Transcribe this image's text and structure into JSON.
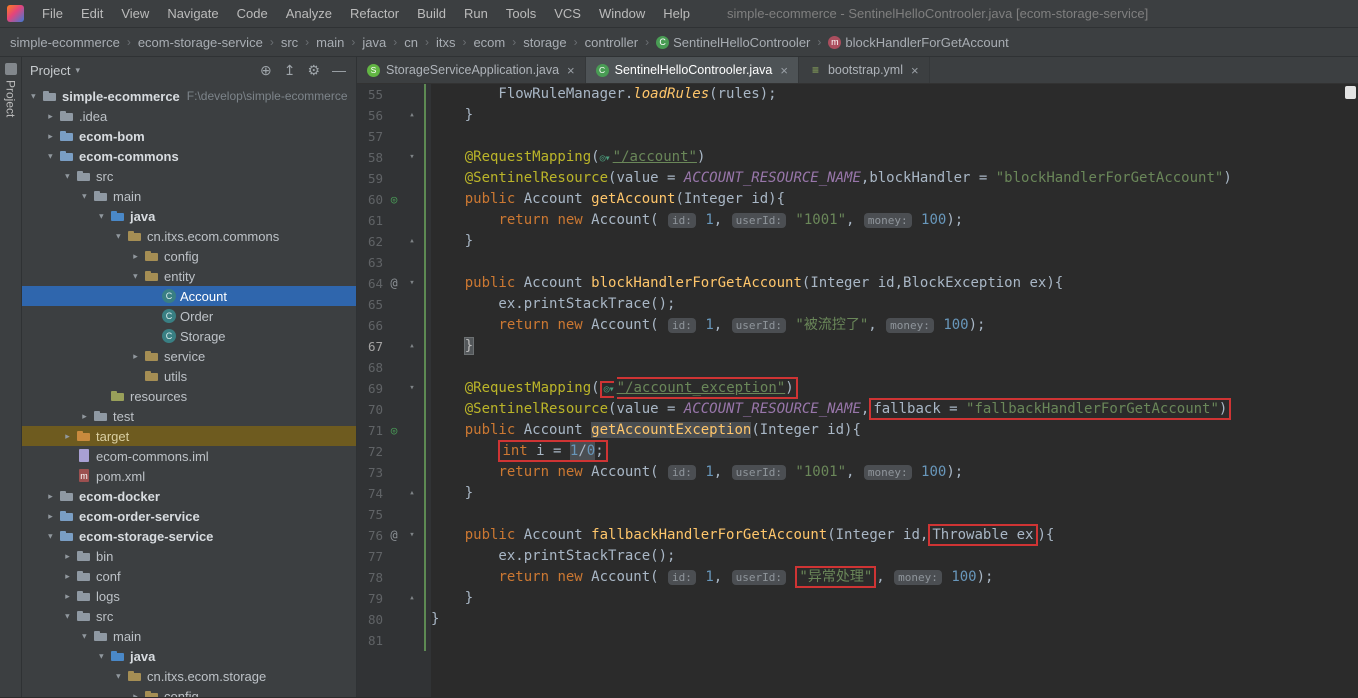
{
  "colors": {
    "selection_blue": "#2f66ad",
    "excluded_row": "#6e5b1f",
    "annotation_box_red": "#cf3434",
    "vcs_change_green": "#5d8a53"
  },
  "titlebar": {
    "title": "simple-ecommerce - SentinelHelloControoler.java [ecom-storage-service]",
    "menu": [
      "File",
      "Edit",
      "View",
      "Navigate",
      "Code",
      "Analyze",
      "Refactor",
      "Build",
      "Run",
      "Tools",
      "VCS",
      "Window",
      "Help"
    ]
  },
  "breadcrumbs": [
    {
      "label": "simple-ecommerce"
    },
    {
      "label": "ecom-storage-service"
    },
    {
      "label": "src"
    },
    {
      "label": "main"
    },
    {
      "label": "java"
    },
    {
      "label": "cn"
    },
    {
      "label": "itxs"
    },
    {
      "label": "ecom"
    },
    {
      "label": "storage"
    },
    {
      "label": "controller"
    },
    {
      "label": "SentinelHelloControoler",
      "icon": "class"
    },
    {
      "label": "blockHandlerForGetAccount",
      "icon": "method"
    }
  ],
  "activity_bar": {
    "project_label": "Project"
  },
  "project_panel": {
    "header": {
      "title": "Project",
      "caret": "▾",
      "actions": [
        {
          "name": "locate-file-icon",
          "glyph": "⊕"
        },
        {
          "name": "collapse-all-icon",
          "glyph": "↥"
        },
        {
          "name": "settings-gear-icon",
          "glyph": "⚙"
        },
        {
          "name": "hide-panel-icon",
          "glyph": "—"
        }
      ]
    },
    "tree": [
      {
        "label": "simple-ecommerce",
        "extra": "F:\\develop\\simple-ecommerce",
        "depth": 0,
        "arrow": "v",
        "icon": "project",
        "bold": true
      },
      {
        "label": ".idea",
        "depth": 1,
        "arrow": ">",
        "icon": "folder"
      },
      {
        "label": "ecom-bom",
        "depth": 1,
        "arrow": ">",
        "icon": "module",
        "bold": true
      },
      {
        "label": "ecom-commons",
        "depth": 1,
        "arrow": "v",
        "icon": "module",
        "bold": true
      },
      {
        "label": "src",
        "depth": 2,
        "arrow": "v",
        "icon": "folder"
      },
      {
        "label": "main",
        "depth": 3,
        "arrow": "v",
        "icon": "folder"
      },
      {
        "label": "java",
        "depth": 4,
        "arrow": "v",
        "icon": "src",
        "bold": true
      },
      {
        "label": "cn.itxs.ecom.commons",
        "depth": 5,
        "arrow": "v",
        "icon": "pkg"
      },
      {
        "label": "config",
        "depth": 6,
        "arrow": ">",
        "icon": "pkg"
      },
      {
        "label": "entity",
        "depth": 6,
        "arrow": "v",
        "icon": "pkg"
      },
      {
        "label": "Account",
        "depth": 7,
        "arrow": "",
        "icon": "class",
        "selected": true
      },
      {
        "label": "Order",
        "depth": 7,
        "arrow": "",
        "icon": "class"
      },
      {
        "label": "Storage",
        "depth": 7,
        "arrow": "",
        "icon": "class"
      },
      {
        "label": "service",
        "depth": 6,
        "arrow": ">",
        "icon": "pkg"
      },
      {
        "label": "utils",
        "depth": 6,
        "arrow": "",
        "icon": "pkg"
      },
      {
        "label": "resources",
        "depth": 4,
        "arrow": "",
        "icon": "res"
      },
      {
        "label": "test",
        "depth": 3,
        "arrow": ">",
        "icon": "folder"
      },
      {
        "label": "target",
        "depth": 2,
        "arrow": ">",
        "icon": "folder-excl",
        "excluded": true
      },
      {
        "label": "ecom-commons.iml",
        "depth": 2,
        "arrow": "",
        "icon": "iml"
      },
      {
        "label": "pom.xml",
        "depth": 2,
        "arrow": "",
        "icon": "xml"
      },
      {
        "label": "ecom-docker",
        "depth": 1,
        "arrow": ">",
        "icon": "folder",
        "bold": true
      },
      {
        "label": "ecom-order-service",
        "depth": 1,
        "arrow": ">",
        "icon": "module",
        "bold": true
      },
      {
        "label": "ecom-storage-service",
        "depth": 1,
        "arrow": "v",
        "icon": "module",
        "bold": true
      },
      {
        "label": "bin",
        "depth": 2,
        "arrow": ">",
        "icon": "folder"
      },
      {
        "label": "conf",
        "depth": 2,
        "arrow": ">",
        "icon": "folder"
      },
      {
        "label": "logs",
        "depth": 2,
        "arrow": ">",
        "icon": "folder"
      },
      {
        "label": "src",
        "depth": 2,
        "arrow": "v",
        "icon": "folder"
      },
      {
        "label": "main",
        "depth": 3,
        "arrow": "v",
        "icon": "folder"
      },
      {
        "label": "java",
        "depth": 4,
        "arrow": "v",
        "icon": "src",
        "bold": true
      },
      {
        "label": "cn.itxs.ecom.storage",
        "depth": 5,
        "arrow": "v",
        "icon": "pkg"
      },
      {
        "label": "config",
        "depth": 6,
        "arrow": ">",
        "icon": "pkg"
      }
    ]
  },
  "tabs": {
    "close_glyph": "×",
    "items": [
      {
        "label": "StorageServiceApplication.java",
        "icon": "spring",
        "active": false
      },
      {
        "label": "SentinelHelloControoler.java",
        "icon": "class",
        "active": true
      },
      {
        "label": "bootstrap.yml",
        "icon": "yml",
        "active": false
      }
    ]
  },
  "editor": {
    "lines": [
      {
        "num": 55,
        "seg": [
          [
            "        FlowRuleManager.",
            "p"
          ],
          [
            "loadRules",
            "sm"
          ],
          [
            "(rules);",
            "p"
          ]
        ]
      },
      {
        "num": 56,
        "fold": "^",
        "seg": [
          [
            "    }",
            "p"
          ]
        ]
      },
      {
        "num": 57,
        "seg": []
      },
      {
        "num": 58,
        "fold": "v",
        "seg": [
          [
            "    @RequestMapping",
            "a"
          ],
          [
            "(",
            "p"
          ],
          [
            "◎▾",
            "ic"
          ],
          [
            "\"/account\"",
            "u"
          ],
          [
            ")",
            "p"
          ]
        ]
      },
      {
        "num": 59,
        "seg": [
          [
            "    @SentinelResource",
            "a"
          ],
          [
            "(value = ",
            "p"
          ],
          [
            "ACCOUNT_RESOURCE_NAME",
            "co"
          ],
          [
            ",blockHandler = ",
            "p"
          ],
          [
            "\"blockHandlerForGetAccount\"",
            "s"
          ],
          [
            ")",
            "p"
          ]
        ]
      },
      {
        "num": 60,
        "gut": "spring",
        "seg": [
          [
            "    ",
            "p"
          ],
          [
            "public ",
            "k"
          ],
          [
            "Account ",
            "p"
          ],
          [
            "getAccount",
            "me"
          ],
          [
            "(Integer id){",
            "p"
          ]
        ]
      },
      {
        "num": 61,
        "seg": [
          [
            "        ",
            "p"
          ],
          [
            "return new ",
            "k"
          ],
          [
            "Account( ",
            "p"
          ],
          [
            "id:",
            "h"
          ],
          [
            " ",
            "p"
          ],
          [
            "1",
            "n"
          ],
          [
            ", ",
            "p"
          ],
          [
            "userId:",
            "h"
          ],
          [
            " ",
            "p"
          ],
          [
            "\"1001\"",
            "s"
          ],
          [
            ", ",
            "p"
          ],
          [
            "money:",
            "h"
          ],
          [
            " ",
            "p"
          ],
          [
            "100",
            "n"
          ],
          [
            ");",
            "p"
          ]
        ]
      },
      {
        "num": 62,
        "fold": "^",
        "seg": [
          [
            "    }",
            "p"
          ]
        ]
      },
      {
        "num": 63,
        "seg": []
      },
      {
        "num": 64,
        "fold": "v",
        "gut": "at",
        "seg": [
          [
            "    ",
            "p"
          ],
          [
            "public ",
            "k"
          ],
          [
            "Account ",
            "p"
          ],
          [
            "blockHandlerForGetAccount",
            "me"
          ],
          [
            "(Integer id,BlockException ex){",
            "p"
          ]
        ]
      },
      {
        "num": 65,
        "seg": [
          [
            "        ex.printStackTrace();",
            "p"
          ]
        ]
      },
      {
        "num": 66,
        "seg": [
          [
            "        ",
            "p"
          ],
          [
            "return new ",
            "k"
          ],
          [
            "Account( ",
            "p"
          ],
          [
            "id:",
            "h"
          ],
          [
            " ",
            "p"
          ],
          [
            "1",
            "n"
          ],
          [
            ", ",
            "p"
          ],
          [
            "userId:",
            "h"
          ],
          [
            " ",
            "p"
          ],
          [
            "\"被流控了\"",
            "s"
          ],
          [
            ", ",
            "p"
          ],
          [
            "money:",
            "h"
          ],
          [
            " ",
            "p"
          ],
          [
            "100",
            "n"
          ],
          [
            ");",
            "p"
          ]
        ]
      },
      {
        "num": 67,
        "cur": true,
        "fold": "^",
        "seg": [
          [
            "    ",
            "p"
          ],
          [
            "}",
            "bm"
          ]
        ]
      },
      {
        "num": 68,
        "seg": []
      },
      {
        "num": 69,
        "fold": "v",
        "seg": [
          [
            "    @RequestMapping",
            "a"
          ],
          [
            "(",
            "p"
          ],
          [
            "◎▾",
            "ic rb rbl"
          ],
          [
            "\"/account_exception\"",
            "u rb"
          ],
          [
            ")",
            "p rb rbr"
          ]
        ]
      },
      {
        "num": 70,
        "seg": [
          [
            "    @SentinelResource",
            "a"
          ],
          [
            "(value = ",
            "p"
          ],
          [
            "ACCOUNT_RESOURCE_NAME",
            "co"
          ],
          [
            ",",
            "p"
          ],
          [
            "fallback = ",
            "p rb rbl"
          ],
          [
            "\"fallbackHandlerForGetAccount\"",
            "s rb"
          ],
          [
            ")",
            "p rb rbr"
          ]
        ]
      },
      {
        "num": 71,
        "gut": "spring",
        "seg": [
          [
            "    ",
            "p"
          ],
          [
            "public ",
            "k"
          ],
          [
            "Account ",
            "p"
          ],
          [
            "getAccountException",
            "me hl"
          ],
          [
            "(Integer id){",
            "p"
          ]
        ]
      },
      {
        "num": 72,
        "seg": [
          [
            "        ",
            "p"
          ],
          [
            "int ",
            "k rb rbl"
          ],
          [
            "i = ",
            "p rb"
          ],
          [
            "1",
            "n hl rb"
          ],
          [
            "/",
            "p hl rb"
          ],
          [
            "0",
            "n hl rb"
          ],
          [
            ";",
            "p rb rbr"
          ]
        ]
      },
      {
        "num": 73,
        "seg": [
          [
            "        ",
            "p"
          ],
          [
            "return new ",
            "k"
          ],
          [
            "Account( ",
            "p"
          ],
          [
            "id:",
            "h"
          ],
          [
            " ",
            "p"
          ],
          [
            "1",
            "n"
          ],
          [
            ", ",
            "p"
          ],
          [
            "userId:",
            "h"
          ],
          [
            " ",
            "p"
          ],
          [
            "\"1001\"",
            "s"
          ],
          [
            ", ",
            "p"
          ],
          [
            "money:",
            "h"
          ],
          [
            " ",
            "p"
          ],
          [
            "100",
            "n"
          ],
          [
            ");",
            "p"
          ]
        ]
      },
      {
        "num": 74,
        "fold": "^",
        "seg": [
          [
            "    }",
            "p"
          ]
        ]
      },
      {
        "num": 75,
        "seg": []
      },
      {
        "num": 76,
        "fold": "v",
        "gut": "at",
        "seg": [
          [
            "    ",
            "p"
          ],
          [
            "public ",
            "k"
          ],
          [
            "Account ",
            "p"
          ],
          [
            "fallbackHandlerForGetAccount",
            "me"
          ],
          [
            "(Integer id,",
            "p"
          ],
          [
            "Throwable ex",
            "p rb rbl rbr"
          ],
          [
            "){",
            "p"
          ]
        ]
      },
      {
        "num": 77,
        "seg": [
          [
            "        ex.printStackTrace();",
            "p"
          ]
        ]
      },
      {
        "num": 78,
        "seg": [
          [
            "        ",
            "p"
          ],
          [
            "return new ",
            "k"
          ],
          [
            "Account( ",
            "p"
          ],
          [
            "id:",
            "h"
          ],
          [
            " ",
            "p"
          ],
          [
            "1",
            "n"
          ],
          [
            ", ",
            "p"
          ],
          [
            "userId:",
            "h"
          ],
          [
            " ",
            "p"
          ],
          [
            "\"异常处理\"",
            "s rb rbl rbr"
          ],
          [
            ", ",
            "p"
          ],
          [
            "money:",
            "h"
          ],
          [
            " ",
            "p"
          ],
          [
            "100",
            "n"
          ],
          [
            ");",
            "p"
          ]
        ]
      },
      {
        "num": 79,
        "fold": "^",
        "seg": [
          [
            "    }",
            "p"
          ]
        ]
      },
      {
        "num": 80,
        "seg": [
          [
            "}",
            "p"
          ]
        ]
      },
      {
        "num": 81,
        "seg": []
      }
    ]
  },
  "glyphs": {
    "breadcrumb_separator": "›",
    "tree_arrow": "▸",
    "fold_open": "▾",
    "fold_end": "▴",
    "gutter_spring": "◎",
    "gutter_at": "@",
    "class": "C",
    "method": "m",
    "spring": "S",
    "yml": "≡",
    "icon_letters": {
      "class": "C",
      "xml": "m"
    }
  }
}
